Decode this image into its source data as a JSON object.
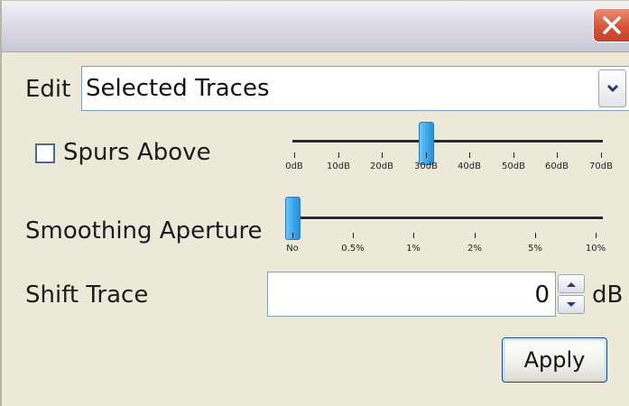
{
  "titlebar": {
    "close_icon": "close-icon"
  },
  "edit": {
    "label": "Edit",
    "selected": "Selected Traces"
  },
  "spurs": {
    "label": "Spurs Above",
    "checked": false,
    "ticks": [
      "0dB",
      "10dB",
      "20dB",
      "30dB",
      "40dB",
      "50dB",
      "60dB",
      "70dB"
    ],
    "value_index": 3
  },
  "smoothing": {
    "label": "Smoothing Aperture",
    "ticks": [
      "No",
      "0.5%",
      "1%",
      "2%",
      "5%",
      "10%"
    ],
    "value_index": 0
  },
  "shift": {
    "label": "Shift Trace",
    "value": "0",
    "unit": "dB"
  },
  "apply": {
    "label": "Apply"
  },
  "colors": {
    "thumb": "#3aa6ec",
    "close": "#d5553a",
    "background": "#ece9d8"
  }
}
